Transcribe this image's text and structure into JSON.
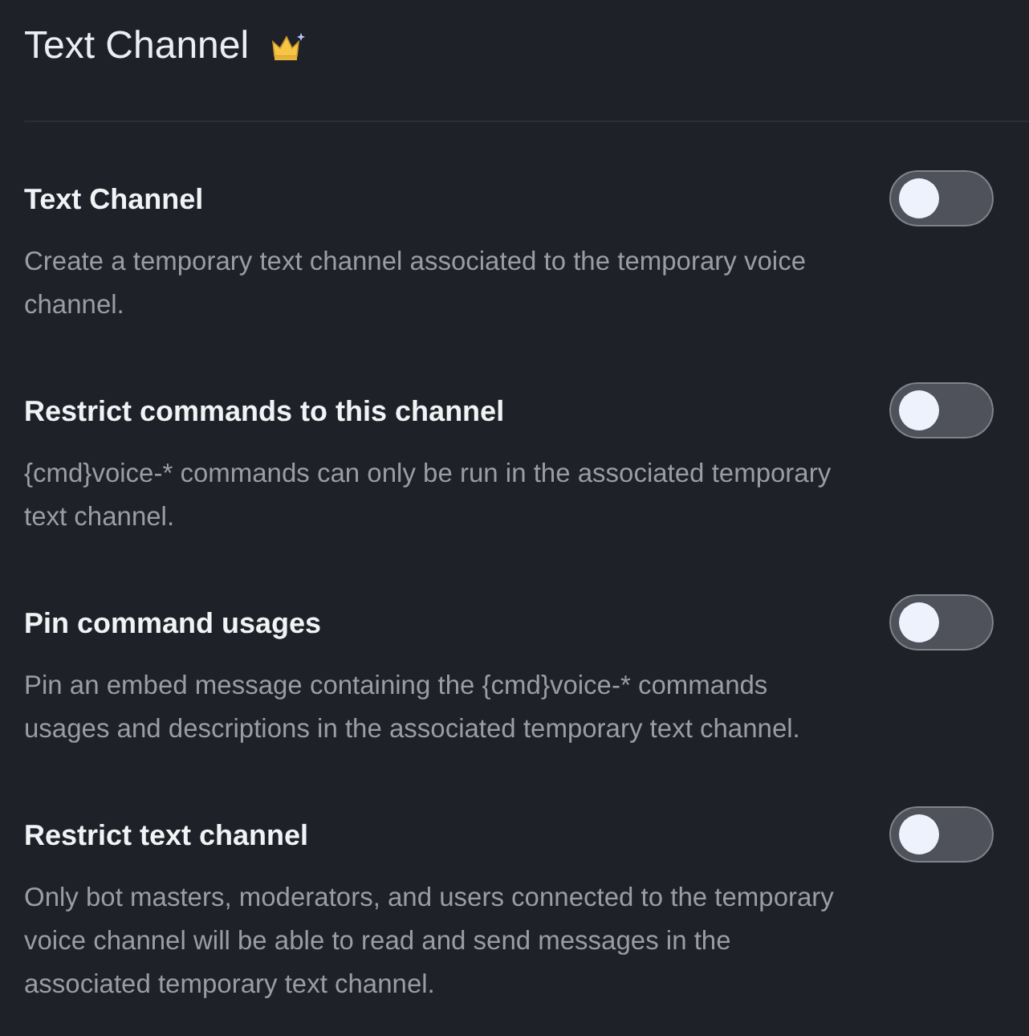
{
  "header": {
    "title": "Text Channel"
  },
  "settings": [
    {
      "title": "Text Channel",
      "description": "Create a temporary text channel associated to the temporary voice channel.",
      "on": false
    },
    {
      "title": "Restrict commands to this channel",
      "description": "{cmd}voice-* commands can only be run in the associated temporary text channel.",
      "on": false
    },
    {
      "title": "Pin command usages",
      "description": "Pin an embed message containing the {cmd}voice-* commands usages and descriptions in the associated temporary text channel.",
      "on": false
    },
    {
      "title": "Restrict text channel",
      "description": "Only bot masters, moderators, and users connected to the temporary voice channel will be able to read and send messages in the associated temporary text channel.",
      "on": false
    }
  ]
}
